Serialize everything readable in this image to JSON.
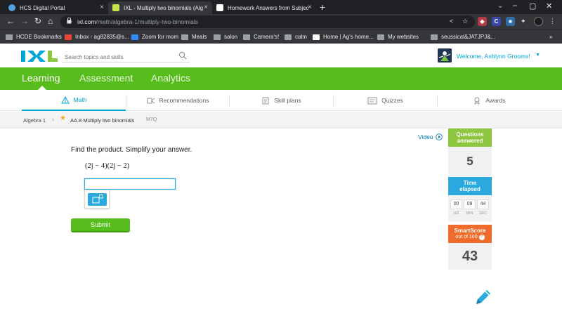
{
  "browser": {
    "tabs": [
      {
        "title": "HCS Digital Portal",
        "active": false
      },
      {
        "title": "IXL - Multiply two binomials (Alg",
        "active": true
      },
      {
        "title": "Homework Answers from Subjec",
        "active": false
      }
    ],
    "new_tab": "+",
    "url_host": "ixl.com",
    "url_path": "/math/algebra-1/multiply-two-binomials",
    "bookmarks": [
      "HCDE Bookmarks",
      "Inbox - ag82835@s...",
      "Zoom for mom",
      "Meals",
      "salon",
      "Camera's!",
      "calm",
      "Home | Ag's home...",
      "My websites",
      "seussical&JATJPJ&..."
    ],
    "bookmarks_more": "»",
    "extension_letter": "C"
  },
  "header": {
    "search_placeholder": "Search topics and skills",
    "welcome": "Welcome, Ashlynn Grooms!"
  },
  "main_nav": [
    "Learning",
    "Assessment",
    "Analytics"
  ],
  "sub_nav": [
    "Math",
    "Recommendations",
    "Skill plans",
    "Quizzes",
    "Awards"
  ],
  "breadcrumb": {
    "parent": "Algebra 1",
    "current": "AA.8 Multiply two binomials",
    "code": "M7Q"
  },
  "question": {
    "video_label": "Video",
    "prompt": "Find the product. Simplify your answer.",
    "expression": "(2j − 4)(2j − 2)",
    "answer_value": "",
    "submit_label": "Submit"
  },
  "stats": {
    "questions_label_1": "Questions",
    "questions_label_2": "answered",
    "questions_answered": "5",
    "time_label_1": "Time",
    "time_label_2": "elapsed",
    "timer": {
      "hr": "00",
      "min": "09",
      "sec": "44",
      "hr_label": "HR",
      "min_label": "MIN",
      "sec_label": "SEC"
    },
    "smartscore_label": "SmartScore",
    "smartscore_sub": "out of 100",
    "help": "?",
    "smartscore": "43"
  },
  "colors": {
    "ixl_green": "#57bd1c",
    "ixl_blue": "#00a5d8",
    "questions_head": "#8dc63f",
    "time_head": "#29a9de",
    "smartscore_head": "#ef6c2d"
  }
}
